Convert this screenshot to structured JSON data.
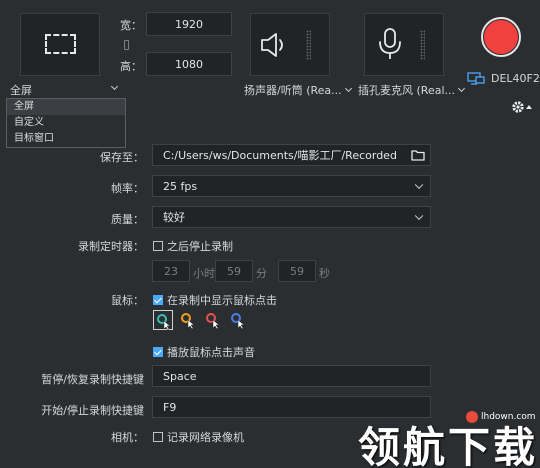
{
  "top": {
    "mode_label": "全屏",
    "width_label": "宽：",
    "height_label": "高：",
    "width_value": "1920",
    "height_value": "1080",
    "speaker_label": "扬声器/听筒 (Rea...",
    "mic_label": "插孔麦克风 (Real...",
    "display_label": "DEL40F2"
  },
  "dropdown": {
    "items": [
      "全屏",
      "自定义",
      "目标窗口"
    ],
    "selected_index": 0
  },
  "settings": {
    "save_label": "保存至：",
    "save_path": "C:/Users/ws/Documents/喵影工厂/Recorded",
    "fps_label": "帧率：",
    "fps_value": "25 fps",
    "quality_label": "质量：",
    "quality_value": "较好",
    "timer_label": "录制定时器：",
    "timer_check": "之后停止录制",
    "timer_hours": "23",
    "timer_hours_unit": "小时",
    "timer_minutes": "59",
    "timer_minutes_unit": "分",
    "timer_seconds": "59",
    "timer_seconds_unit": "秒",
    "mouse_label": "鼠标：",
    "mouse_show_clicks": "在录制中显示鼠标点击",
    "mouse_play_sound": "播放鼠标点击声音",
    "pause_hotkey_label": "暂停/恢复录制快捷键",
    "pause_hotkey_value": "Space",
    "start_hotkey_label": "开始/停止录制快捷键",
    "start_hotkey_value": "F9",
    "camera_label": "相机：",
    "camera_check": "记录网络录像机"
  },
  "colors": {
    "record": "#f0413f",
    "checkbox_on": "#4aa8ff",
    "cursor_colors": [
      "#36c0b4",
      "#f0a020",
      "#e85050",
      "#4a7ee8"
    ]
  },
  "watermark": {
    "site": "lhdown.com",
    "text": "领航下载"
  }
}
